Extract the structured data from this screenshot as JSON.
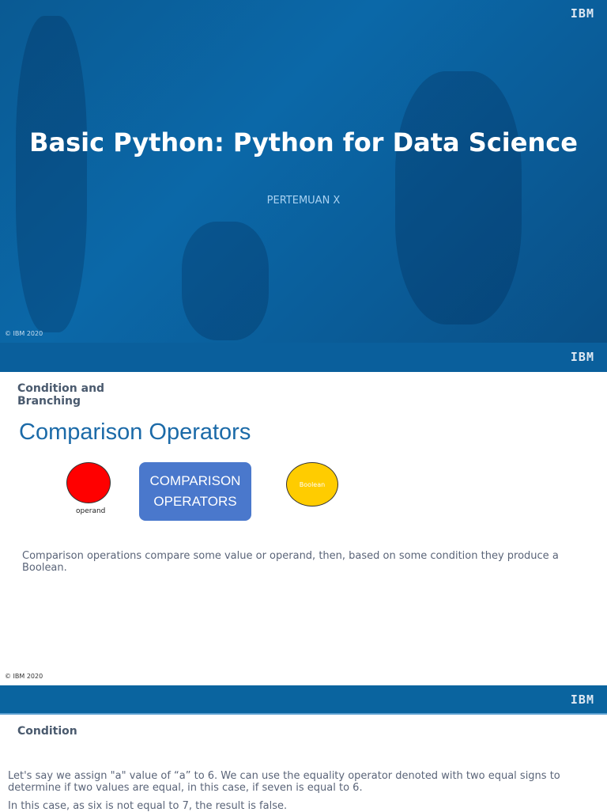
{
  "slide1": {
    "logo": "IBM",
    "title": "Basic Python: Python for Data Science",
    "subtitle": "PERTEMUAN X",
    "copyright": "© IBM 2020"
  },
  "slide2": {
    "logo": "IBM",
    "heading": "Condition and Branching",
    "title": "Comparison Operators",
    "diagram": {
      "left_label": "operand",
      "box_label": "COMPARISON OPERATORS",
      "right_label": "Boolean",
      "colors": {
        "operand": "#ff0000",
        "box": "#4a78cc",
        "boolean": "#ffcc00"
      }
    },
    "body": "Comparison operations compare some value or operand, then, based on some condition they produce a Boolean.",
    "copyright": "© IBM 2020"
  },
  "slide3": {
    "logo": "IBM",
    "heading": "Condition",
    "body1": "Let's say we assign \"a\" value of “a” to 6. We can use the equality operator denoted with two equal signs to determine if two values are equal, in this case, if seven is equal to 6.",
    "body2": "In this case, as six is not equal to 7, the result is false."
  }
}
